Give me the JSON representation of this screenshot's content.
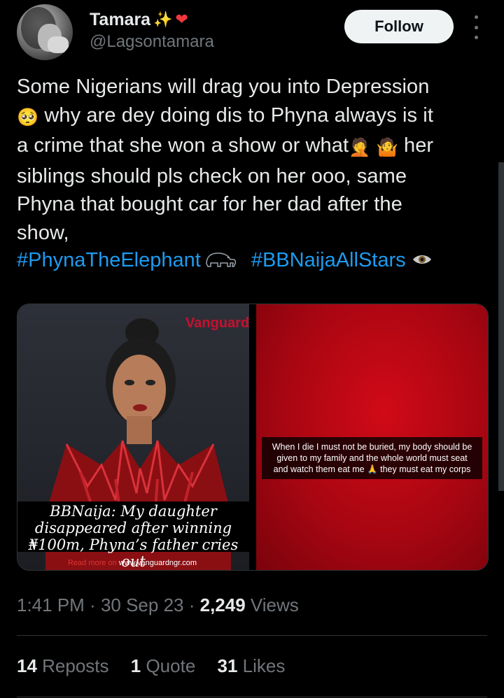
{
  "author": {
    "display_name": "Tamara",
    "handle": "@Lagsontamara",
    "badges": [
      "sparkles-icon",
      "red-heart-icon"
    ]
  },
  "follow_label": "Follow",
  "tweet": {
    "line1": "Some Nigerians will drag you into Depression",
    "line2": " why are dey doing dis to Phyna always is it",
    "line3a": "a crime that she won a show or what",
    "line3b": " her",
    "line4": "siblings should pls check on her ooo, same",
    "line5": "Phyna that bought car for her dad after the",
    "line6": "show,",
    "hashtag1": "#PhynaTheElephant",
    "hashtag2": "#BBNaijaAllStars"
  },
  "media": {
    "left": {
      "watermark": "Vanguard",
      "caption_line1": "BBNaija: My daughter",
      "caption_line2": "disappeared after winning",
      "caption_line3": "₦100m, Phyna’s father cries out",
      "readmore_prefix": "Read more on",
      "readmore_url": "www.vanguardngr.com"
    },
    "right": {
      "story_text_1": "When I die I must not be buried, my body should be",
      "story_text_2": "given to my family and the whole world must seat",
      "story_text_3": "and watch them eat me",
      "story_text_4": " they must eat my corps"
    }
  },
  "meta": {
    "time": "1:41 PM",
    "sep": " · ",
    "date": "30 Sep 23",
    "views_count": "2,249",
    "views_label": " Views"
  },
  "stats": {
    "reposts_count": "14",
    "reposts_label": " Reposts",
    "quotes_count": "1",
    "quotes_label": " Quote",
    "likes_count": "31",
    "likes_label": " Likes"
  },
  "colors": {
    "background": "#000000",
    "link": "#1d9bf0",
    "muted": "#71767b",
    "text": "#e7e9ea"
  }
}
